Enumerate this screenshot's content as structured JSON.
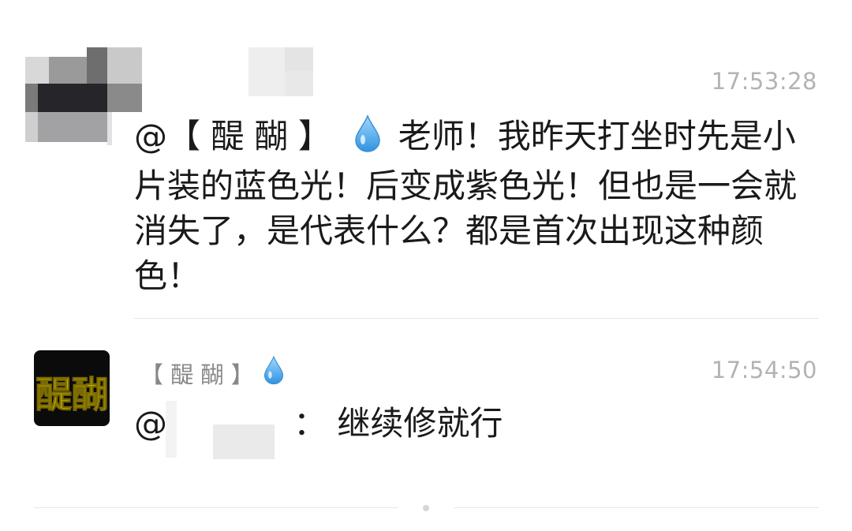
{
  "messages": [
    {
      "time": "17:53:28",
      "mention_prefix": "@【 醍 醐 】",
      "text_after_icon": " 老师！我昨天打坐时先是小片装的蓝色光！后变成紫色光！但也是一会就消失了，是代表什么？都是首次出现这种颜色！",
      "avatar": "pixelated-avatar",
      "drop_icon": "water-drop-icon"
    },
    {
      "time": "17:54:50",
      "sender_name": "【 醍 醐 】",
      "avatar": "brand-avatar-tihu",
      "avatar_text": "醍醐",
      "reply_prefix": "@",
      "reply_text": "： 继续修就行",
      "drop_icon": "water-drop-icon"
    }
  ],
  "colors": {
    "time": "#b3b3b3",
    "text": "#1a1a1a",
    "sender": "#888888",
    "divider": "#e6e6e6",
    "avatar_bg": "#0b0b0b",
    "avatar_text": "#f5d90a",
    "drop": "#5cb6f2"
  }
}
